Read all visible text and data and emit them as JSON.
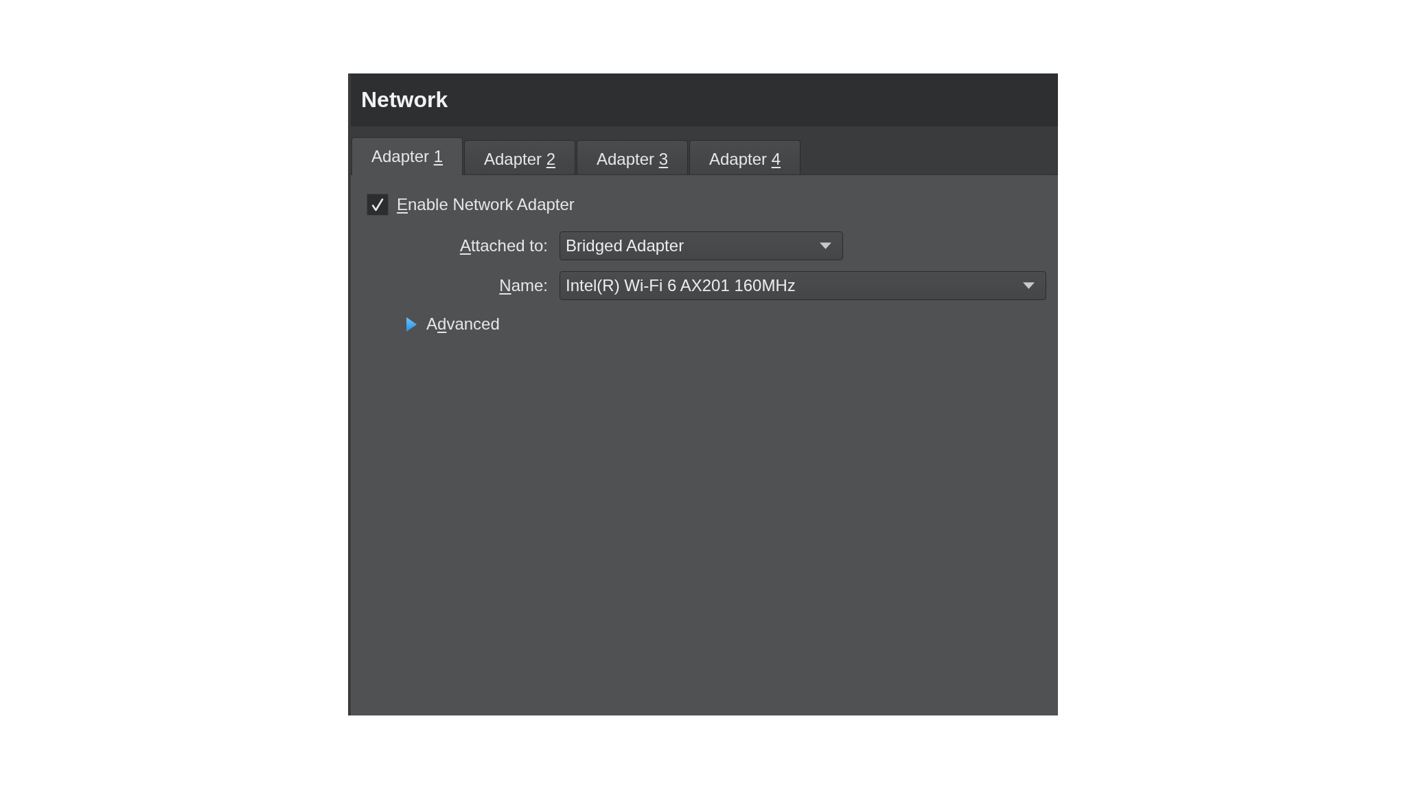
{
  "panel": {
    "title": "Network"
  },
  "tabs": [
    {
      "label": [
        {
          "text": "Adapter ",
          "underlined": false
        },
        {
          "text": "1",
          "underlined": true
        }
      ],
      "selected": true
    },
    {
      "label": [
        {
          "text": "Adapter ",
          "underlined": false
        },
        {
          "text": "2",
          "underlined": true
        }
      ],
      "selected": false
    },
    {
      "label": [
        {
          "text": "Adapter ",
          "underlined": false
        },
        {
          "text": "3",
          "underlined": true
        }
      ],
      "selected": false
    },
    {
      "label": [
        {
          "text": "Adapter ",
          "underlined": false
        },
        {
          "text": "4",
          "underlined": true
        }
      ],
      "selected": false
    }
  ],
  "enable_adapter": {
    "label": [
      {
        "text": "E",
        "underlined": true
      },
      {
        "text": "nable Network Adapter",
        "underlined": false
      }
    ],
    "checked": true
  },
  "fields": [
    {
      "label": [
        {
          "text": "A",
          "underlined": true
        },
        {
          "text": "ttached to:",
          "underlined": false
        }
      ],
      "value": "Bridged Adapter"
    },
    {
      "label": [
        {
          "text": "N",
          "underlined": true
        },
        {
          "text": "ame:",
          "underlined": false
        }
      ],
      "value": "Intel(R) Wi-Fi 6 AX201 160MHz"
    }
  ],
  "advanced": {
    "label": [
      {
        "text": "A",
        "underlined": false
      },
      {
        "text": "d",
        "underlined": true
      },
      {
        "text": "vanced",
        "underlined": false
      }
    ],
    "expanded": false
  }
}
